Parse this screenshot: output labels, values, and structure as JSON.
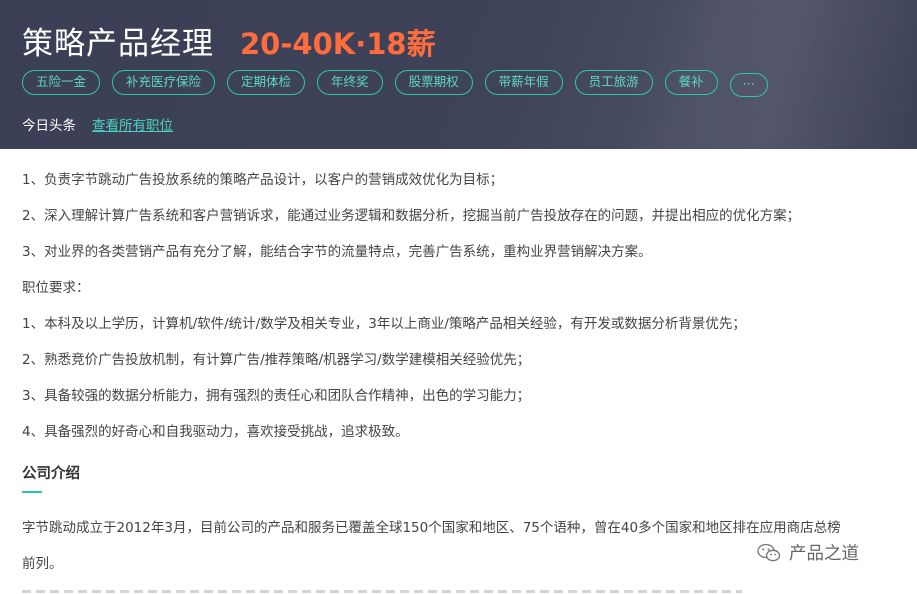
{
  "header": {
    "job_title": "策略产品经理",
    "salary": "20-40K·18薪",
    "tags": [
      "五险一金",
      "补充医疗保险",
      "定期体检",
      "年终奖",
      "股票期权",
      "带薪年假",
      "员工旅游",
      "餐补"
    ],
    "more_tag": "···",
    "company": "今日头条",
    "all_jobs_link": "查看所有职位"
  },
  "description": {
    "duties": [
      "1、负责字节跳动广告投放系统的策略产品设计，以客户的营销成效优化为目标；",
      "2、深入理解计算广告系统和客户营销诉求，能通过业务逻辑和数据分析，挖掘当前广告投放存在的问题，并提出相应的优化方案；",
      "3、对业界的各类营销产品有充分了解，能结合字节的流量特点，完善广告系统，重构业界营销解决方案。"
    ],
    "requirements_heading": "职位要求：",
    "requirements": [
      "1、本科及以上学历，计算机/软件/统计/数学及相关专业，3年以上商业/策略产品相关经验，有开发或数据分析背景优先；",
      "2、熟悉竞价广告投放机制，有计算广告/推荐策略/机器学习/数学建模相关经验优先；",
      "3、具备较强的数据分析能力，拥有强烈的责任心和团队合作精神，出色的学习能力；",
      "4、具备强烈的好奇心和自我驱动力，喜欢接受挑战，追求极致。"
    ]
  },
  "company_intro": {
    "heading": "公司介绍",
    "text_line1": "字节跳动成立于2012年3月，目前公司的产品和服务已覆盖全球150个国家和地区、75个语种，曾在40多个国家和地区排在应用商店总榜",
    "text_line2": "前列。"
  },
  "watermark": {
    "text": "产品之道",
    "icon": "wechat-icon"
  },
  "colors": {
    "accent": "#2fc3b1",
    "salary": "#ff6c3d",
    "header_bg": "#3f4359"
  }
}
